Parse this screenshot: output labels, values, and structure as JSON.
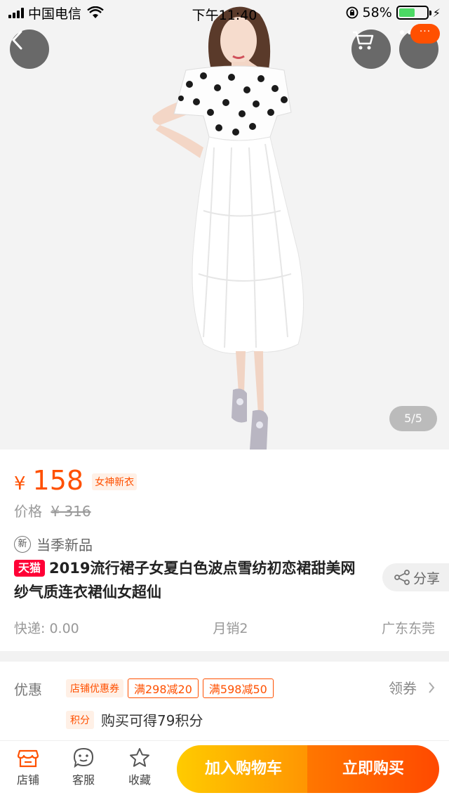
{
  "status_bar": {
    "carrier": "中国电信",
    "time": "下午11:40",
    "battery_percent": "58%",
    "battery_level": 0.58,
    "icons": [
      "signal-icon",
      "wifi-icon",
      "rotation-lock-icon",
      "battery-icon",
      "charging-icon"
    ]
  },
  "gallery": {
    "page_counter": "5/5",
    "more_badge": "···"
  },
  "product": {
    "currency": "¥",
    "price": "158",
    "price_tag": "女神新衣",
    "original_label": "价格",
    "original_price": "¥ 316",
    "season_badge": "新",
    "season_label": "当季新品",
    "platform_badge": "天猫",
    "title": "2019流行裙子女夏白色波点雪纺初恋裙甜美网纱气质连衣裙仙女超仙",
    "share_label": "分享",
    "shipping": "快递: 0.00",
    "monthly_sales": "月销2",
    "location": "广东东莞"
  },
  "promo": {
    "label": "优惠",
    "shop_coupon": "店铺优惠券",
    "coupons": [
      "满298减20",
      "满598减50"
    ],
    "get_coupon": "领券",
    "points_tag": "积分",
    "points_text": "购买可得79积分"
  },
  "bottom_bar": {
    "shop": "店铺",
    "service": "客服",
    "favorite": "收藏",
    "add_to_cart": "加入购物车",
    "buy_now": "立即购买"
  },
  "colors": {
    "accent": "#ff5000",
    "tmall_red": "#ff0036",
    "cart_gradient": [
      "#ffcb00",
      "#ff9402"
    ],
    "buy_gradient": [
      "#ff7700",
      "#ff4900"
    ]
  }
}
